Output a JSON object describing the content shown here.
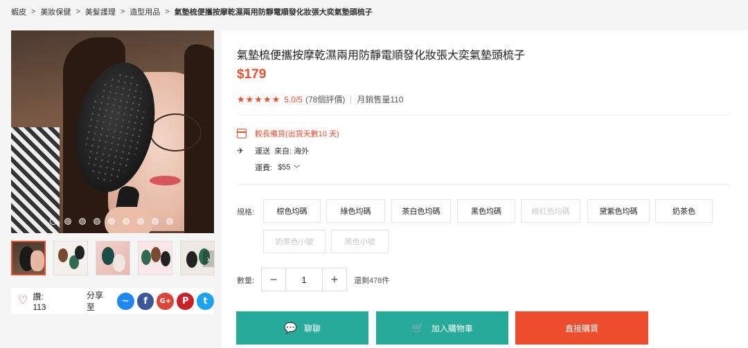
{
  "breadcrumb": [
    "蝦皮",
    "美妝保健",
    "美髮護理",
    "造型用品",
    "氣墊梳便攜按摩乾濕兩用防靜電順發化妝張大奕氣墊頭梳子"
  ],
  "breadcrumb_separator": ">",
  "gallery": {
    "dots": 9,
    "active_dot": 0,
    "thumbs": 5,
    "active_thumb": 0,
    "next_arrow": "›"
  },
  "social": {
    "like_label": "讚: 113",
    "share_label": "分享至",
    "networks": [
      {
        "name": "messenger",
        "glyph": "~",
        "color": "#1e88f5"
      },
      {
        "name": "facebook",
        "glyph": "f",
        "color": "#3b5998"
      },
      {
        "name": "google-plus",
        "glyph": "G+",
        "color": "#db4437"
      },
      {
        "name": "pinterest",
        "glyph": "P",
        "color": "#cb2027"
      },
      {
        "name": "twitter",
        "glyph": "t",
        "color": "#1da1f2"
      }
    ]
  },
  "product": {
    "title": "氣墊梳便攜按摩乾濕兩用防靜電順發化妝張大奕氣墊頭梳子",
    "price": "$179",
    "rating_stars": 5,
    "rating_score": "5.0/5",
    "rating_count": "(78個評價)",
    "monthly_sales": "月銷售量110"
  },
  "shipping": {
    "preorder": "較長備貨(出貨天數10 天)",
    "ship_from_label": "運送",
    "ship_from_value": "來自: 海外",
    "fee_label": "運費:",
    "fee_value": "$55"
  },
  "variation": {
    "label": "規格:",
    "options": [
      {
        "label": "棕色均碼",
        "disabled": false
      },
      {
        "label": "綠色均碼",
        "disabled": false
      },
      {
        "label": "茶白色均碼",
        "disabled": false
      },
      {
        "label": "黑色均碼",
        "disabled": false
      },
      {
        "label": "緋紅色均碼",
        "disabled": true
      },
      {
        "label": "黛紫色均碼",
        "disabled": false
      },
      {
        "label": "奶茶色",
        "disabled": false
      },
      {
        "label": "奶茶色小號",
        "disabled": true
      },
      {
        "label": "黑色小號",
        "disabled": true
      }
    ]
  },
  "quantity": {
    "label": "數量:",
    "minus": "−",
    "value": "1",
    "plus": "+",
    "stock": "還剩478件"
  },
  "actions": {
    "chat": "聊聊",
    "add_to_cart": "加入購物車",
    "buy_now": "直接購買"
  },
  "colors": {
    "accent": "#ee4d2d",
    "teal": "#26aa99"
  }
}
